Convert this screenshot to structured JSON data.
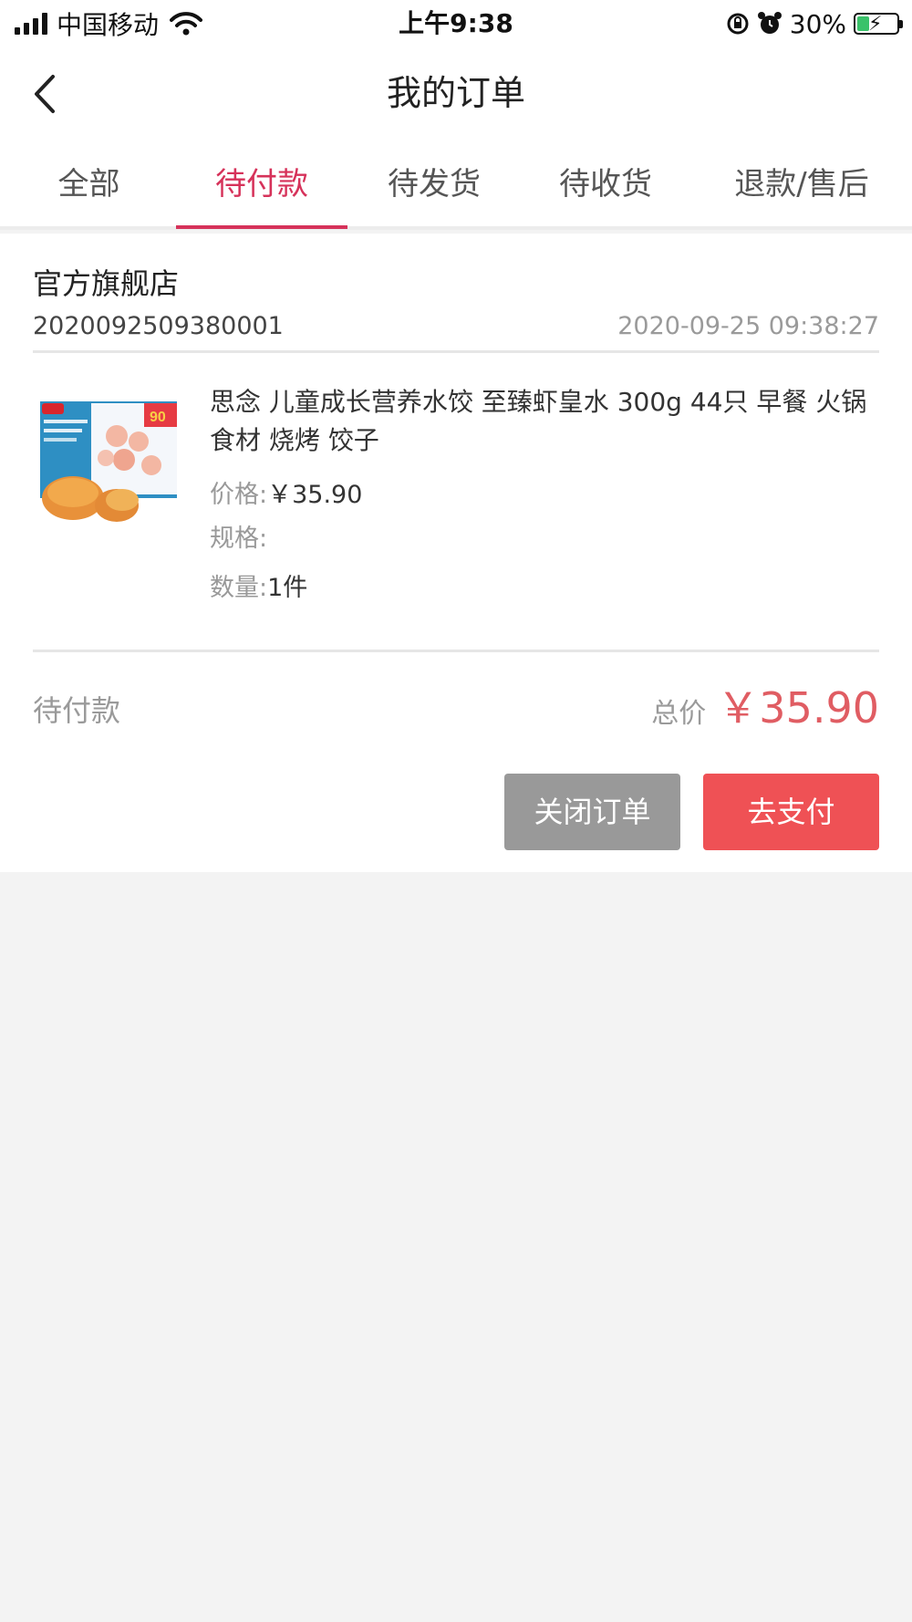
{
  "status_bar": {
    "carrier": "中国移动",
    "time": "上午9:38",
    "battery": "30%",
    "battery_level": 0.3
  },
  "nav": {
    "title": "我的订单"
  },
  "tabs": [
    {
      "label": "全部"
    },
    {
      "label": "待付款"
    },
    {
      "label": "待发货"
    },
    {
      "label": "待收货"
    },
    {
      "label": "退款/售后"
    }
  ],
  "active_tab": 1,
  "colors": {
    "accent": "#d6325a",
    "price": "#e05d63",
    "pay_button": "#ef5155",
    "close_button": "#999999",
    "background": "#f3f3f3"
  },
  "order": {
    "shop": "官方旗舰店",
    "order_no": "2020092509380001",
    "time": "2020-09-25 09:38:27",
    "product": {
      "title": "思念 儿童成长营养水饺 至臻虾皇水 300g 44只 早餐 火锅食材 烧烤 饺子",
      "price_label": "价格:",
      "price": "￥35.90",
      "spec_label": "规格:",
      "spec": "",
      "qty_label": "数量:",
      "qty": "1件"
    },
    "status": "待付款",
    "total_label": "总价",
    "total": "￥35.90",
    "buttons": {
      "close": "关闭订单",
      "pay": "去支付"
    }
  }
}
